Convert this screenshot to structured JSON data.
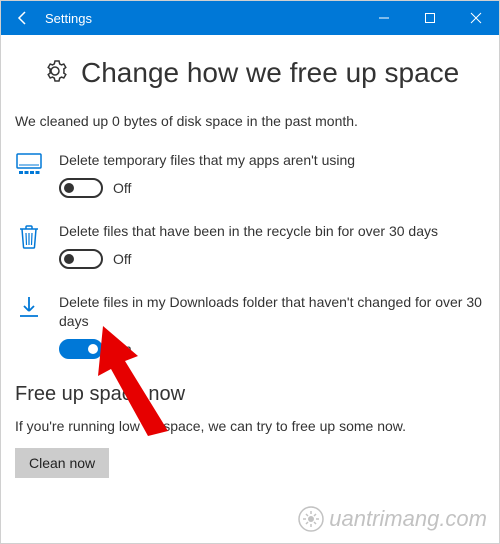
{
  "titlebar": {
    "title": "Settings"
  },
  "header": {
    "title": "Change how we free up space"
  },
  "status": "We cleaned up 0 bytes of disk space in the past month.",
  "settings": [
    {
      "label": "Delete temporary files that my apps aren't using",
      "state_text": "Off",
      "state": "off"
    },
    {
      "label": "Delete files that have been in the recycle bin for over 30 days",
      "state_text": "Off",
      "state": "off"
    },
    {
      "label": "Delete files in my Downloads folder that haven't changed for over 30 days",
      "state_text": "On",
      "state": "on"
    }
  ],
  "section": {
    "title": "Free up space now",
    "desc": "If you're running low on space, we can try to free up some now.",
    "button": "Clean now"
  },
  "watermark": "uantrimang.com",
  "colors": {
    "accent": "#0078d7"
  }
}
